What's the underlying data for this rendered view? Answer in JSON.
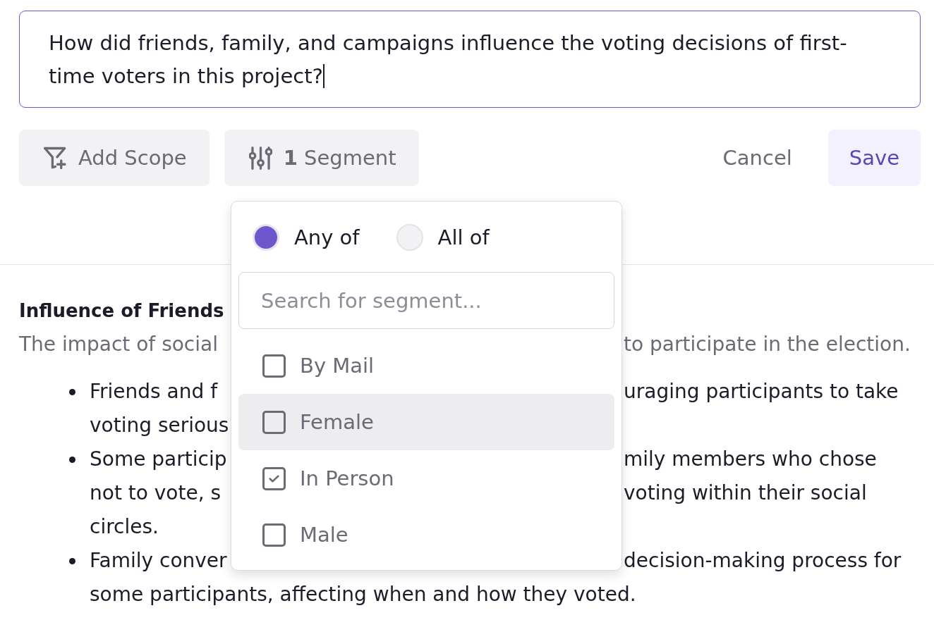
{
  "question": {
    "value": "How did friends, family, and campaigns influence the voting decisions of first-time voters in this project?",
    "focused": true
  },
  "toolbar": {
    "buttons": [
      {
        "kind": "scope",
        "label": "Add Scope"
      },
      {
        "kind": "segment",
        "label": "**1** Segment"
      }
    ],
    "actions": [
      {
        "kind": "text",
        "label": "Cancel"
      },
      {
        "kind": "primary",
        "label": "Save"
      }
    ]
  },
  "section": {
    "heading": "Influence of Friends",
    "description": {
      "left": "The impact of social",
      "right": "to participate in the election."
    },
    "bullets": [
      {
        "lines": [
          {
            "left": "Friends and f",
            "right": "uraging participants to take"
          },
          {
            "left": "voting serious"
          }
        ]
      },
      {
        "lines": [
          {
            "left": "Some particip",
            "right": "mily members who chose"
          },
          {
            "left": "not to vote, s",
            "right": "voting within their social"
          },
          {
            "left": "circles."
          }
        ]
      },
      {
        "lines": [
          {
            "left": "Family conver",
            "right": "decision-making process for"
          },
          {
            "left": "some participants, affecting when and how they voted."
          }
        ]
      }
    ]
  },
  "segment_menu": {
    "match_modes": [
      {
        "label": "Any of",
        "selected": true
      },
      {
        "label": "All of",
        "selected": false
      }
    ],
    "search": {
      "placeholder": "Search for segment..."
    },
    "options": [
      {
        "label": "By Mail",
        "checked": false,
        "highlighted": false
      },
      {
        "label": "Female",
        "checked": false,
        "highlighted": true
      },
      {
        "label": "In Person",
        "checked": true,
        "highlighted": false
      },
      {
        "label": "Male",
        "checked": false,
        "highlighted": false
      }
    ]
  }
}
